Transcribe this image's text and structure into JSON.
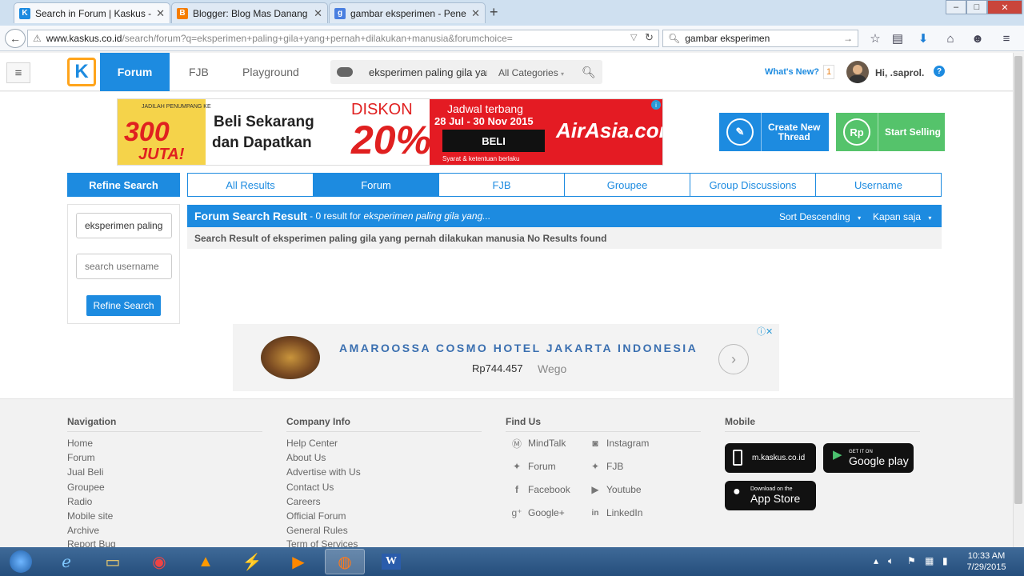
{
  "browser": {
    "tabs": [
      {
        "title": "Search in Forum | Kaskus - ...",
        "active": true
      },
      {
        "title": "Blogger: Blog Mas Danang ...",
        "active": false
      },
      {
        "title": "gambar eksperimen - Pene...",
        "active": false
      }
    ],
    "url_domain": "www.kaskus.co.id",
    "url_path": "/search/forum?q=eksperimen+paling+gila+yang+pernah+dilakukan+manusia&forumchoice=",
    "search_value": "gambar eksperimen"
  },
  "header": {
    "logo_letter": "K",
    "nav_forum": "Forum",
    "nav_fjb": "FJB",
    "nav_playground": "Playground",
    "search_value": "eksperimen paling gila yang",
    "category": "All Categories",
    "whats_new": "What's New?",
    "notif_count": "1",
    "greeting": "Hi, .saprol.",
    "help": "?"
  },
  "ad_banner": {
    "jadilah": "JADILAH PENUMPANG KE",
    "n300": "300",
    "juta": "JUTA!",
    "line1": "Beli Sekarang",
    "line2": "dan Dapatkan",
    "diskon": "DISKON",
    "pct": "20%",
    "jadwal": "Jadwal terbang",
    "dates": "28 Jul - 30 Nov 2015",
    "beli": "BELI",
    "syarat": "Syarat & ketentuan berlaku",
    "brand": "AirAsia.com"
  },
  "actions": {
    "create_line1": "Create New",
    "create_line2": "Thread",
    "sell_icon": "Rp",
    "sell_label": "Start Selling"
  },
  "refine": {
    "title": "Refine Search",
    "query_value": "eksperimen paling",
    "username_placeholder": "search username",
    "button": "Refine Search"
  },
  "result_tabs": [
    "All Results",
    "Forum",
    "FJB",
    "Groupee",
    "Group Discussions",
    "Username"
  ],
  "results": {
    "title": "Forum Search Result",
    "count_text": " - 0 result for ",
    "query_italic": "eksperimen paling gila yang...",
    "sort": "Sort Descending",
    "time": "Kapan saja",
    "message": "Search Result of eksperimen paling gila yang pernah dilakukan manusia No Results found"
  },
  "ad_hotel": {
    "name": "AMAROOSSA COSMO HOTEL JAKARTA INDONESIA",
    "price": "Rp744.457",
    "provider": "Wego"
  },
  "footer": {
    "navigation": {
      "title": "Navigation",
      "items": [
        "Home",
        "Forum",
        "Jual Beli",
        "Groupee",
        "Radio",
        "Mobile site",
        "Archive",
        "Report Bug"
      ]
    },
    "company": {
      "title": "Company Info",
      "items": [
        "Help Center",
        "About Us",
        "Advertise with Us",
        "Contact Us",
        "Careers",
        "Official Forum",
        "General Rules",
        "Term of Services"
      ]
    },
    "findus": {
      "title": "Find Us",
      "items": [
        "MindTalk",
        "Instagram",
        "Forum",
        "FJB",
        "Facebook",
        "Youtube",
        "Google+",
        "LinkedIn"
      ]
    },
    "mobile": {
      "title": "Mobile",
      "site": "m.kaskus.co.id",
      "gp_small": "GET IT ON",
      "gp_big": "Google play",
      "as_small": "Download on the",
      "as_big": "App Store"
    }
  },
  "taskbar": {
    "time": "10:33 AM",
    "date": "7/29/2015"
  },
  "colors": {
    "brand_blue": "#1d8be0",
    "sell_green": "#55c36b",
    "logo_orange": "#ffa41b"
  }
}
